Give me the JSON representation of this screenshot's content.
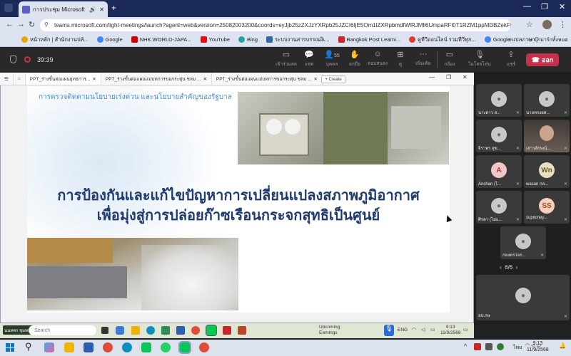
{
  "browser": {
    "tab_title": "การประชุม Microsoft Teams",
    "url": "teams.microsoft.com/light-meetings/launch?agent=web&version=25082003200&coords=eyJjb25zZXJzYXRpb25JZCI6IjE5Om1lZXRpbmdfWlRJMll6UmpaRFl0T1RZM1ppMDBZekF5TFRnNe...",
    "bookmarks": [
      "หน้าหลัก | สำนักงานปลั...",
      "Google",
      "NHK WORLD-JAPA...",
      "YouTube",
      "Bing",
      "ระบบงานสารบรรณอิเ...",
      "Bangkok Post Learni...",
      "ดูทีวีออนไลน์ รวมทีวีทุก...",
      "Google แปลภาษา"
    ],
    "bookmarks_folder": "บุ๊กมาร์กทั้งหมด"
  },
  "teams": {
    "timer": "39:39",
    "toolbar": [
      {
        "label": "เข้าร่วมสด",
        "icon": "chat-join-icon"
      },
      {
        "label": "แชท",
        "icon": "chat-icon"
      },
      {
        "label": "บุคคล",
        "icon": "people-icon",
        "badge": "55"
      },
      {
        "label": "ยกมือ",
        "icon": "raise-hand-icon"
      },
      {
        "label": "ตอบสนอง",
        "icon": "react-icon"
      },
      {
        "label": "ดู",
        "icon": "view-icon"
      },
      {
        "label": "เพิ่มเติม",
        "icon": "more-icon"
      },
      {
        "label": "กล้อง",
        "icon": "camera-icon"
      },
      {
        "label": "ไมโครโฟน",
        "icon": "mic-icon"
      },
      {
        "label": "แชร์",
        "icon": "share-icon"
      }
    ],
    "leave_label": "ออก",
    "participants": [
      {
        "name": "นางสาว ส...",
        "initials": ""
      },
      {
        "name": "นายทรงยศ...",
        "initials": ""
      },
      {
        "name": "จิราพร สุข...",
        "initials": ""
      },
      {
        "name": "เสาวลักษณ์...",
        "initials": "",
        "video": true
      },
      {
        "name": "Anchan (ไ...",
        "initials": "A"
      },
      {
        "name": "wasan กล...",
        "initials": "Wn"
      },
      {
        "name": "ศิรดา (ไม่แ...",
        "initials": ""
      },
      {
        "name": "supitchey...",
        "initials": "SS"
      },
      {
        "name": "กองตรวจร...",
        "initials": ""
      }
    ],
    "pager": "6/6",
    "self_tile": "สป.กษ"
  },
  "ppt": {
    "tabs": [
      "PPT_ร่างขั้นต่อแผนยุทธการ...",
      "PPT_ร่างขั้นต่อแผนแม่บทการขอกระตุ่น ชลม ...",
      "PPT_ร่างขั้นต่อแผนแม่บทการขอกระตุ่น ชลม ..."
    ],
    "create_label": "+ Create",
    "slide_subtitle": "การตรวจติดตามนโยบายเร่งด่วน และนโยบายสำคัญของรัฐบาล",
    "slide_title_1": "การป้องกันและแก้ไขปัญหาการเปลี่ยนแปลงสภาพภูมิอากาศ",
    "slide_title_2": "เพื่อมุ่งสู่การปล่อยก๊าซเรือนกระจกสุทธิเป็นศูนย์"
  },
  "inner_taskbar": {
    "user": "นนทพร ชุมพร",
    "search_placeholder": "Search",
    "upcoming_title": "Upcoming",
    "upcoming_sub": "Earnings",
    "lang": "ENG",
    "time": "9:13",
    "date": "11/9/2568"
  },
  "taskbar": {
    "lang": "ไทย",
    "time": "9:13",
    "date": "11/9/2568"
  },
  "colors": {
    "leave": "#c4314b",
    "title_blue": "#1f3b6e",
    "subtitle_blue": "#4a8fc7",
    "tab_bar": "#1b2a58"
  }
}
